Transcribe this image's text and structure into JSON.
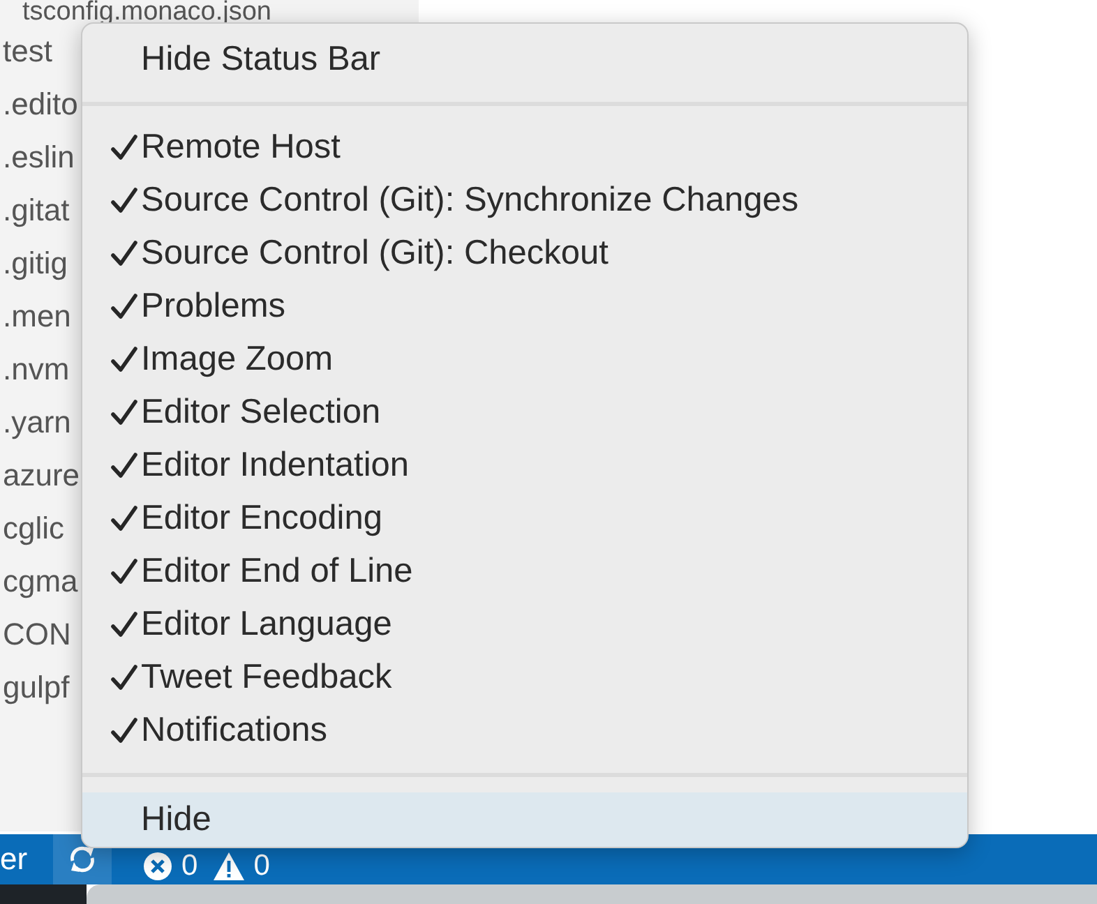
{
  "explorer": {
    "files": [
      {
        "name": "tsconfig.monaco.json"
      },
      {
        "name": "test"
      },
      {
        "name": ".edito"
      },
      {
        "name": ".eslin"
      },
      {
        "name": ".gitat"
      },
      {
        "name": ".gitig"
      },
      {
        "name": ".men"
      },
      {
        "name": ".nvm"
      },
      {
        "name": ".yarn"
      },
      {
        "name": "azure"
      },
      {
        "name": "cglic"
      },
      {
        "name": "cgma"
      },
      {
        "name": "CON"
      },
      {
        "name": "gulpf"
      }
    ]
  },
  "context_menu": {
    "sections": [
      [
        {
          "label": "Hide Status Bar",
          "checked": false,
          "selected": false
        }
      ],
      [
        {
          "label": "Remote Host",
          "checked": true,
          "selected": false
        },
        {
          "label": "Source Control (Git): Synchronize Changes",
          "checked": true,
          "selected": false
        },
        {
          "label": "Source Control (Git): Checkout",
          "checked": true,
          "selected": false
        },
        {
          "label": "Problems",
          "checked": true,
          "selected": false
        },
        {
          "label": "Image Zoom",
          "checked": true,
          "selected": false
        },
        {
          "label": "Editor Selection",
          "checked": true,
          "selected": false
        },
        {
          "label": "Editor Indentation",
          "checked": true,
          "selected": false
        },
        {
          "label": "Editor Encoding",
          "checked": true,
          "selected": false
        },
        {
          "label": "Editor End of Line",
          "checked": true,
          "selected": false
        },
        {
          "label": "Editor Language",
          "checked": true,
          "selected": false
        },
        {
          "label": "Tweet Feedback",
          "checked": true,
          "selected": false
        },
        {
          "label": "Notifications",
          "checked": true,
          "selected": false
        }
      ],
      [
        {
          "label": "Hide",
          "checked": false,
          "selected": true
        }
      ]
    ]
  },
  "status_bar": {
    "left_text": "er",
    "errors": "0",
    "warnings": "0"
  }
}
